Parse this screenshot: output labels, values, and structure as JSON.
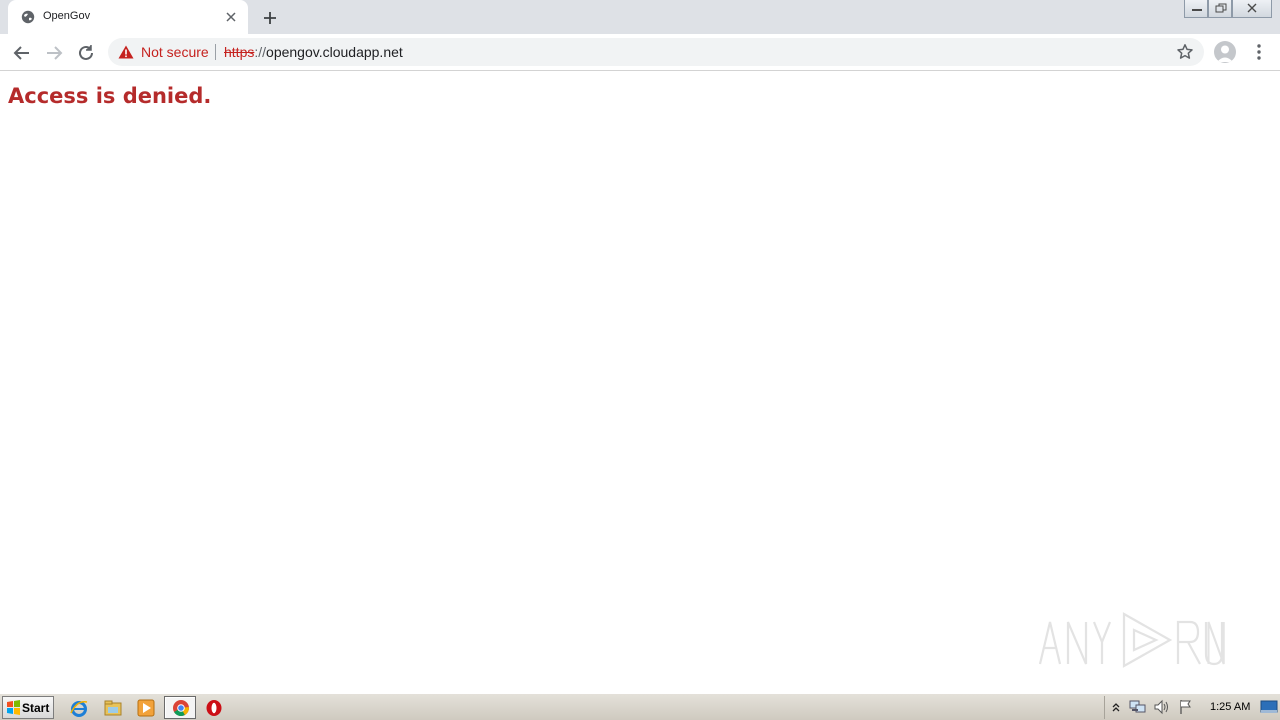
{
  "browser": {
    "tab": {
      "title": "OpenGov",
      "favicon": "globe-icon"
    },
    "omnibox": {
      "security_label": "Not secure",
      "url_scheme": "https",
      "url_separator": "://",
      "url_host": "opengov.cloudapp.net"
    }
  },
  "page": {
    "heading": "Access is denied."
  },
  "watermark": {
    "text": "ANY RUN"
  },
  "taskbar": {
    "start_label": "Start",
    "clock": "1:25 AM"
  },
  "colors": {
    "warning_red": "#c5221f",
    "heading_red": "#b52b2b",
    "tab_strip": "#dee1e6"
  }
}
